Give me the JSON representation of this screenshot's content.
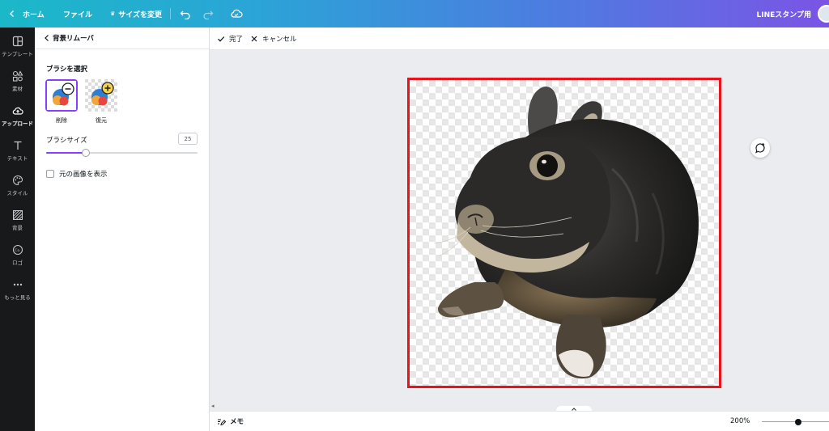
{
  "topbar": {
    "home": "ホーム",
    "file": "ファイル",
    "resize": "サイズを変更",
    "design_title": "LINEスタンプ用"
  },
  "rail": [
    {
      "label": "テンプレート",
      "icon": "template-icon"
    },
    {
      "label": "素材",
      "icon": "elements-icon"
    },
    {
      "label": "アップロード",
      "icon": "upload-icon"
    },
    {
      "label": "テキスト",
      "icon": "text-icon"
    },
    {
      "label": "スタイル",
      "icon": "palette-icon"
    },
    {
      "label": "背景",
      "icon": "background-icon"
    },
    {
      "label": "ロゴ",
      "icon": "logo-icon"
    },
    {
      "label": "もっと見る",
      "icon": "more-icon"
    }
  ],
  "panel": {
    "title": "背景リムーバ",
    "brush_section": "ブラシを選択",
    "brush_erase": "削除",
    "brush_restore": "復元",
    "size_label": "ブラシサイズ",
    "size_value": "25",
    "size_fraction": 0.25,
    "show_original": "元の画像を表示"
  },
  "editbar": {
    "done": "完了",
    "cancel": "キャンセル"
  },
  "bottombar": {
    "memo": "メモ",
    "zoom": "200%",
    "zoom_fraction": 0.55
  },
  "colors": {
    "accent": "#8b3dff",
    "selection": "#e8141b"
  }
}
